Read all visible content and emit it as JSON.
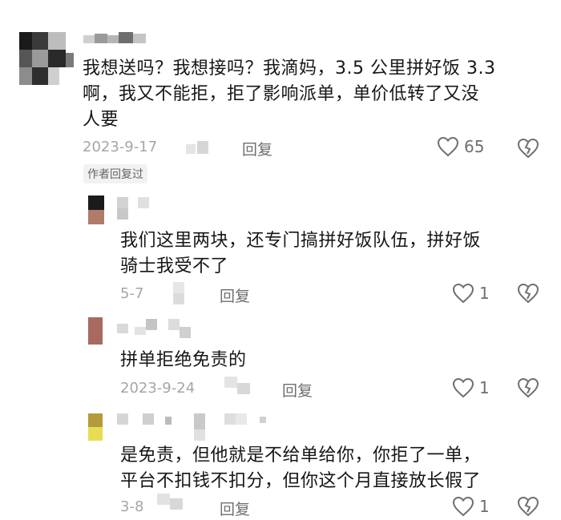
{
  "comments": [
    {
      "text": "我想送吗？我想接吗？我滴妈，3.5 公里拼好饭 3.3 啊，我又不能拒，拒了影响派单，单价低转了又没人要",
      "lines": [
        "我想送吗？我想接吗？我滴妈，3.5 公里拼好饭 3.3",
        "啊，我又不能拒，拒了影响派单，单价低转了又没",
        "人要"
      ],
      "date": "2023-9-17",
      "reply_label": "回复",
      "likes": "65",
      "author_replied": "作者回复过"
    }
  ],
  "replies": [
    {
      "lines": [
        "我们这里两块，还专门搞拼好饭队伍，拼好饭",
        "骑士我受不了"
      ],
      "date": "5-7",
      "reply_label": "回复",
      "likes": "1"
    },
    {
      "lines": [
        "拼单拒绝免责的"
      ],
      "date": "2023-9-24",
      "reply_label": "回复",
      "likes": "1"
    },
    {
      "lines": [
        "是免责，但他就是不给单给你，你拒了一单，",
        "平台不扣钱不扣分，但你这个月直接放长假了"
      ],
      "date": "3-8",
      "reply_label": "回复",
      "likes": "1"
    }
  ],
  "colors": {
    "text": "#161616",
    "meta": "#a6a6a6",
    "action": "#6f6f6f"
  },
  "icons": [
    "heart-outline-icon",
    "broken-heart-icon"
  ]
}
